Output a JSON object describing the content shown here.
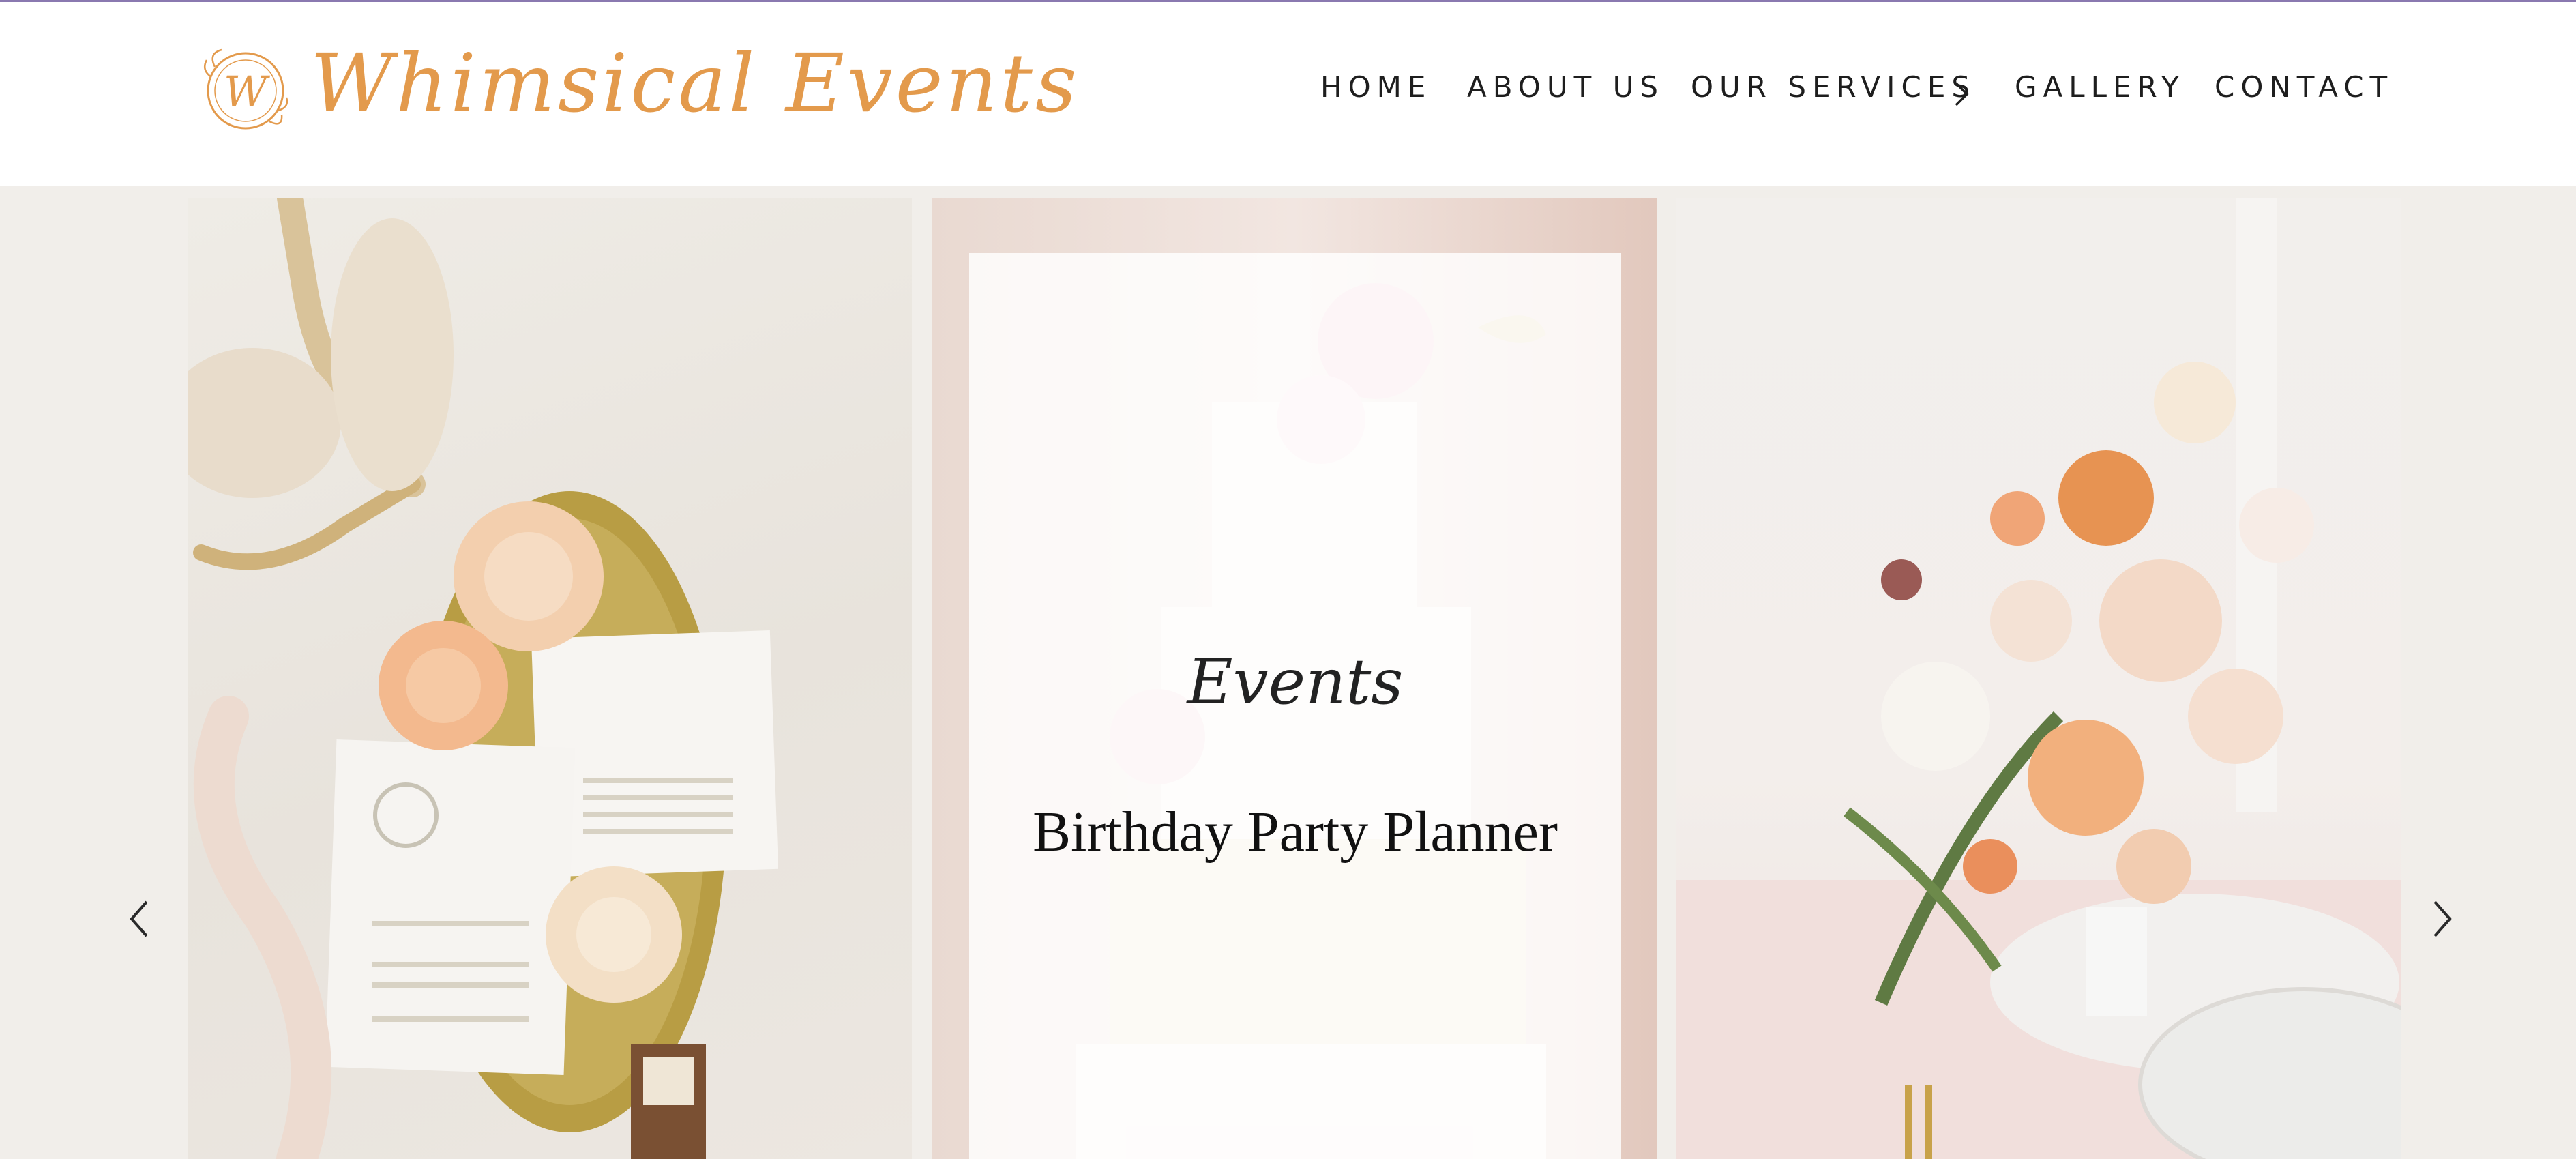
{
  "brand": {
    "name": "Whimsical Events",
    "monogram": "W",
    "color": "#e39a4c"
  },
  "nav": {
    "items": [
      {
        "label": "HOME"
      },
      {
        "label": "ABOUT US"
      },
      {
        "label": "OUR SERVICES"
      },
      {
        "label": "GALLERY"
      },
      {
        "label": "CONTACT"
      }
    ],
    "services_icon": "chevron-right-icon"
  },
  "slider": {
    "slides": [
      {
        "image": "wedding-invitation-flatlay"
      },
      {
        "image": "tiered-wedding-cake",
        "script": "Events",
        "title": "Birthday Party Planner"
      },
      {
        "image": "floral-table-centerpiece"
      }
    ],
    "prev_icon": "chevron-left-icon",
    "next_icon": "chevron-right-icon"
  },
  "colors": {
    "accent_line": "#8a79b0",
    "background": "#f1eeea",
    "nav_text": "#1e1e1e"
  }
}
